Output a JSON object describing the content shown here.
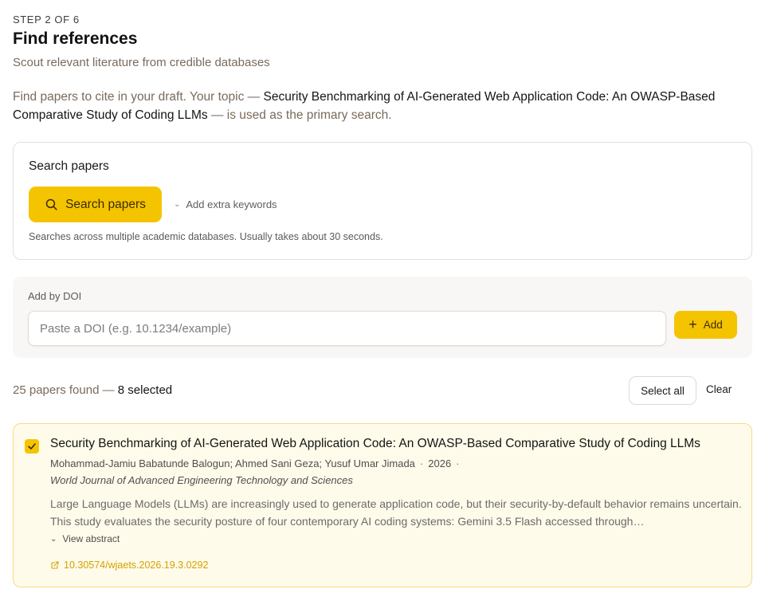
{
  "header": {
    "step": "STEP 2 OF 6",
    "title": "Find references",
    "subtitle": "Scout relevant literature from credible databases"
  },
  "intro": {
    "prefix": "Find papers to cite in your draft. Your topic — ",
    "topic": "Security Benchmarking of AI-Generated Web Application Code: An OWASP-Based Comparative Study of Coding LLMs",
    "suffix": " — is used as the primary search."
  },
  "search": {
    "card_title": "Search papers",
    "button_label": "Search papers",
    "button_icon": "search-icon",
    "extra_keywords_label": "Add extra keywords",
    "note": "Searches across multiple academic databases. Usually takes about 30 seconds."
  },
  "doi": {
    "label": "Add by DOI",
    "value": "",
    "placeholder": "Paste a DOI (e.g. 10.1234/example)",
    "add_label": "Add",
    "add_icon": "plus-icon"
  },
  "results": {
    "count_text": "25 papers found — ",
    "selected_text": "8 selected",
    "select_all_label": "Select all",
    "clear_label": "Clear"
  },
  "papers": [
    {
      "selected": true,
      "title": "Security Benchmarking of AI-Generated Web Application Code: An OWASP-Based Comparative Study of Coding LLMs",
      "authors": "Mohammad-Jamiu Babatunde Balogun; Ahmed Sani Geza; Yusuf Umar Jimada",
      "year": "2026",
      "journal": "World Journal of Advanced Engineering Technology and Sciences",
      "abstract": "Large Language Models (LLMs) are increasingly used to generate application code, but their security-by-default behavior remains uncertain. This study evaluates the security posture of four contemporary AI coding systems: Gemini 3.5 Flash accessed through…",
      "view_abstract_label": "View abstract",
      "doi": "10.30574/wjaets.2026.19.3.0292"
    }
  ],
  "colors": {
    "accent": "#f5c400",
    "muted_text": "#7a6a5c",
    "card_selected_bg": "#fffbea",
    "card_selected_border": "#f3dc85",
    "doi_link": "#d4a200"
  }
}
